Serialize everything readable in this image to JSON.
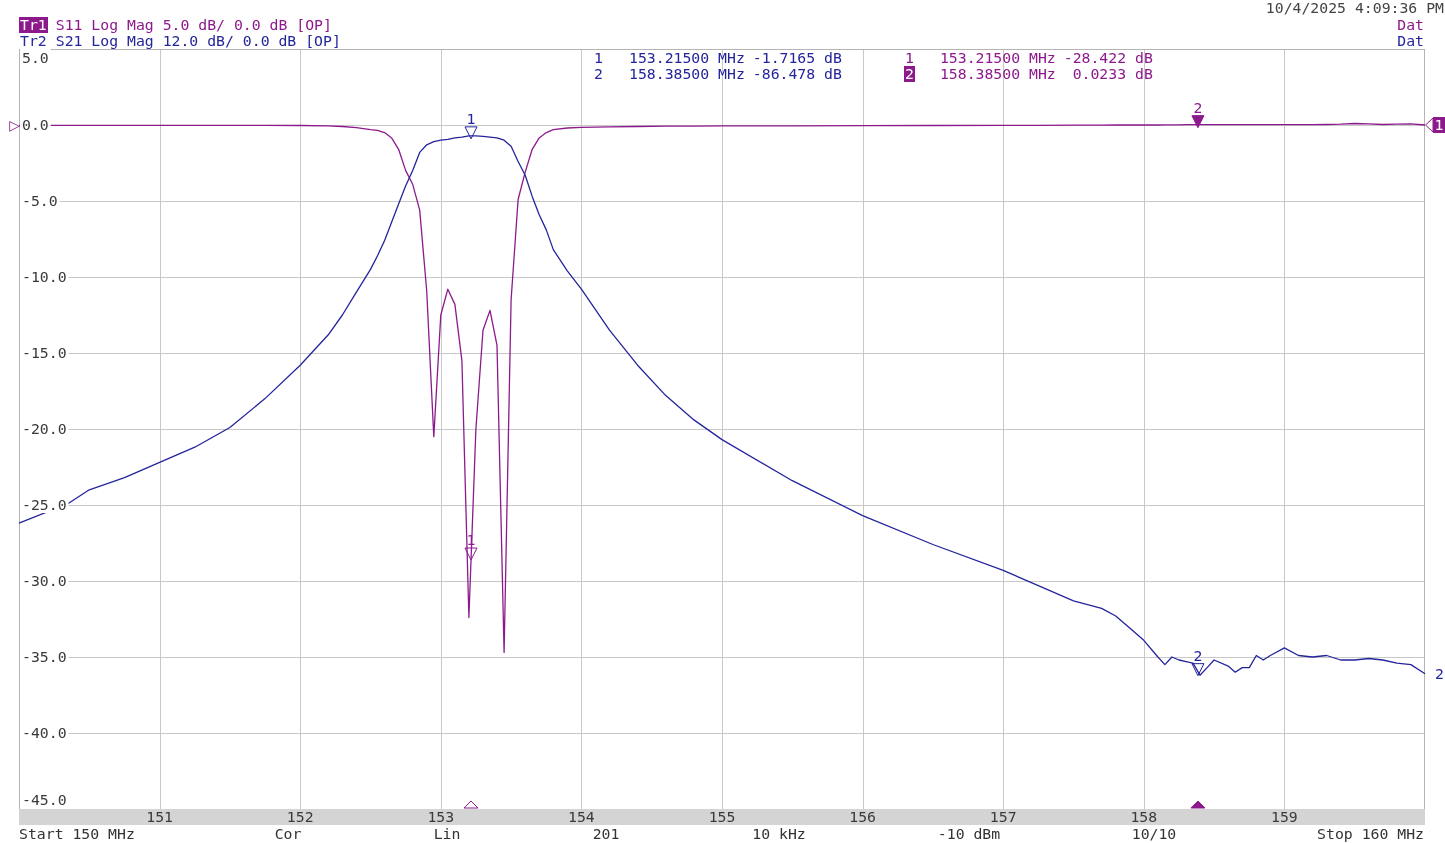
{
  "header": {
    "timestamp": "10/4/2025 4:09:36 PM"
  },
  "traces": [
    {
      "id": "Tr1",
      "params": "S11 Log Mag 5.0 dB/ 0.0 dB [OP]",
      "status": "Dat",
      "end_label": "1",
      "color": "#8c1a8c",
      "selected": true
    },
    {
      "id": "Tr2",
      "params": "S21 Log Mag 12.0 dB/ 0.0 dB [OP]",
      "status": "Dat",
      "end_label": "2",
      "color": "#24249c",
      "selected": false
    }
  ],
  "plot": {
    "marker_readouts": [
      {
        "color": "#24249c",
        "rows": [
          {
            "marker": "1",
            "stimulus": "153.21500 MHz",
            "response": "-1.7165 dB",
            "selected": false
          },
          {
            "marker": "2",
            "stimulus": "158.38500 MHz",
            "response": "-86.478 dB",
            "selected": false
          }
        ]
      },
      {
        "color": "#8c1a8c",
        "rows": [
          {
            "marker": "1",
            "stimulus": "153.21500 MHz",
            "response": "-28.422 dB",
            "selected": false
          },
          {
            "marker": "2",
            "stimulus": "158.38500 MHz",
            "response": "0.0233 dB",
            "selected": true
          }
        ]
      }
    ],
    "chart_data": {
      "type": "line",
      "x": [
        150,
        150.35,
        150.5,
        150.75,
        151,
        151.25,
        151.5,
        151.75,
        152,
        152.2,
        152.3,
        152.4,
        152.5,
        152.55,
        152.6,
        152.65,
        152.7,
        152.75,
        152.8,
        152.85,
        152.9,
        152.95,
        153,
        153.05,
        153.1,
        153.15,
        153.2,
        153.25,
        153.3,
        153.35,
        153.4,
        153.45,
        153.5,
        153.55,
        153.6,
        153.65,
        153.7,
        153.75,
        153.8,
        153.9,
        154,
        154.2,
        154.4,
        154.6,
        154.8,
        155,
        155.5,
        156,
        156.5,
        157,
        157.25,
        157.5,
        157.7,
        157.8,
        157.9,
        158,
        158.1,
        158.15,
        158.2,
        158.25,
        158.3,
        158.35,
        158.4,
        158.45,
        158.5,
        158.6,
        158.65,
        158.7,
        158.75,
        158.8,
        158.85,
        158.9,
        159,
        159.1,
        159.2,
        159.3,
        159.4,
        159.5,
        159.6,
        159.7,
        159.8,
        159.9,
        160
      ],
      "series": [
        {
          "color": "#8c1a8c",
          "values": [
            -0.02,
            -0.02,
            -0.02,
            -0.02,
            -0.02,
            -0.02,
            -0.02,
            -0.02,
            -0.03,
            -0.06,
            -0.1,
            -0.18,
            -0.3,
            -0.35,
            -0.5,
            -0.85,
            -1.6,
            -3.0,
            -3.9,
            -5.6,
            -10.9,
            -20.5,
            -12.5,
            -10.8,
            -11.8,
            -15.5,
            -32.4,
            -20.0,
            -13.5,
            -12.2,
            -14.5,
            -34.7,
            -11.5,
            -4.9,
            -3.1,
            -1.6,
            -0.85,
            -0.5,
            -0.3,
            -0.2,
            -0.15,
            -0.12,
            -0.1,
            -0.08,
            -0.07,
            -0.06,
            -0.05,
            -0.04,
            -0.03,
            -0.02,
            -0.02,
            -0.01,
            -0.01,
            0,
            0,
            0,
            0,
            0.01,
            0.01,
            0.01,
            0.02,
            0.02,
            0.02,
            0.02,
            0.02,
            0.02,
            0.02,
            0.02,
            0.02,
            0.02,
            0.02,
            0.02,
            0.02,
            0.02,
            0.02,
            0.03,
            0.05,
            0.1,
            0.08,
            0.03,
            0.06,
            0.08,
            0.0
          ]
        },
        {
          "color": "#24249c",
          "values": [
            -26.2,
            -24.9,
            -24.0,
            -23.2,
            -22.2,
            -21.2,
            -19.9,
            -18.0,
            -15.8,
            -13.8,
            -12.5,
            -11.0,
            -9.5,
            -8.6,
            -7.6,
            -6.4,
            -5.2,
            -4.0,
            -3.0,
            -1.8,
            -1.3,
            -1.1,
            -1.0,
            -0.95,
            -0.85,
            -0.8,
            -0.72,
            -0.72,
            -0.75,
            -0.8,
            -0.85,
            -1.0,
            -1.4,
            -2.4,
            -3.3,
            -4.7,
            -5.9,
            -6.9,
            -8.2,
            -9.6,
            -10.8,
            -13.5,
            -15.8,
            -17.8,
            -19.4,
            -20.7,
            -23.4,
            -25.7,
            -27.6,
            -29.3,
            -30.3,
            -31.3,
            -31.8,
            -32.3,
            -33.1,
            -33.9,
            -35.0,
            -35.5,
            -35.0,
            -35.2,
            -35.3,
            -35.4,
            -36.2,
            -35.7,
            -35.2,
            -35.6,
            -36.0,
            -35.7,
            -35.7,
            -34.9,
            -35.2,
            -34.9,
            -34.4,
            -34.9,
            -35.0,
            -34.9,
            -35.2,
            -35.2,
            -35.1,
            -35.2,
            -35.4,
            -35.5,
            -36.1
          ]
        }
      ],
      "xlim": [
        150,
        160
      ],
      "ylim": [
        -45,
        5
      ],
      "grid": true,
      "xticks": [
        151,
        152,
        153,
        154,
        155,
        156,
        157,
        158,
        159
      ],
      "yticks": [
        {
          "value": 5,
          "label": "5.0"
        },
        {
          "value": 0,
          "label": "0.0"
        },
        {
          "value": -5,
          "label": "-5.0"
        },
        {
          "value": -10,
          "label": "-10.0"
        },
        {
          "value": -15,
          "label": "-15.0"
        },
        {
          "value": -20,
          "label": "-20.0"
        },
        {
          "value": -25,
          "label": "-25.0"
        },
        {
          "value": -30,
          "label": "-30.0"
        },
        {
          "value": -35,
          "label": "-35.0"
        },
        {
          "value": -40,
          "label": "-40.0"
        },
        {
          "value": -45,
          "label": "-45.0"
        }
      ],
      "annotations": [
        {
          "x": 153.215,
          "y": -0.715,
          "text": "1"
        },
        {
          "x": 158.385,
          "y": -36.03,
          "text": "2"
        },
        {
          "x": 153.215,
          "y": -28.422,
          "text": "1"
        },
        {
          "x": 158.385,
          "y": 0.0233,
          "text": "2"
        },
        {
          "x": 150,
          "y": 0,
          "text": "▷"
        }
      ]
    }
  },
  "status_bar": [
    "Start 150 MHz",
    "Cor",
    "Lin",
    "201",
    "10 kHz",
    "-10 dBm",
    "10/10",
    "Stop 160 MHz"
  ]
}
